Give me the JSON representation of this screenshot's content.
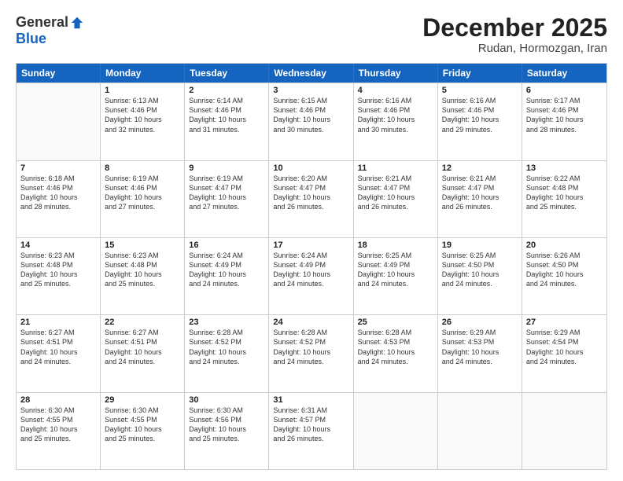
{
  "logo": {
    "general": "General",
    "blue": "Blue"
  },
  "header": {
    "month": "December 2025",
    "location": "Rudan, Hormozgan, Iran"
  },
  "days_of_week": [
    "Sunday",
    "Monday",
    "Tuesday",
    "Wednesday",
    "Thursday",
    "Friday",
    "Saturday"
  ],
  "weeks": [
    [
      {
        "day": "",
        "info": ""
      },
      {
        "day": "1",
        "info": "Sunrise: 6:13 AM\nSunset: 4:46 PM\nDaylight: 10 hours\nand 32 minutes."
      },
      {
        "day": "2",
        "info": "Sunrise: 6:14 AM\nSunset: 4:46 PM\nDaylight: 10 hours\nand 31 minutes."
      },
      {
        "day": "3",
        "info": "Sunrise: 6:15 AM\nSunset: 4:46 PM\nDaylight: 10 hours\nand 30 minutes."
      },
      {
        "day": "4",
        "info": "Sunrise: 6:16 AM\nSunset: 4:46 PM\nDaylight: 10 hours\nand 30 minutes."
      },
      {
        "day": "5",
        "info": "Sunrise: 6:16 AM\nSunset: 4:46 PM\nDaylight: 10 hours\nand 29 minutes."
      },
      {
        "day": "6",
        "info": "Sunrise: 6:17 AM\nSunset: 4:46 PM\nDaylight: 10 hours\nand 28 minutes."
      }
    ],
    [
      {
        "day": "7",
        "info": "Sunrise: 6:18 AM\nSunset: 4:46 PM\nDaylight: 10 hours\nand 28 minutes."
      },
      {
        "day": "8",
        "info": "Sunrise: 6:19 AM\nSunset: 4:46 PM\nDaylight: 10 hours\nand 27 minutes."
      },
      {
        "day": "9",
        "info": "Sunrise: 6:19 AM\nSunset: 4:47 PM\nDaylight: 10 hours\nand 27 minutes."
      },
      {
        "day": "10",
        "info": "Sunrise: 6:20 AM\nSunset: 4:47 PM\nDaylight: 10 hours\nand 26 minutes."
      },
      {
        "day": "11",
        "info": "Sunrise: 6:21 AM\nSunset: 4:47 PM\nDaylight: 10 hours\nand 26 minutes."
      },
      {
        "day": "12",
        "info": "Sunrise: 6:21 AM\nSunset: 4:47 PM\nDaylight: 10 hours\nand 26 minutes."
      },
      {
        "day": "13",
        "info": "Sunrise: 6:22 AM\nSunset: 4:48 PM\nDaylight: 10 hours\nand 25 minutes."
      }
    ],
    [
      {
        "day": "14",
        "info": "Sunrise: 6:23 AM\nSunset: 4:48 PM\nDaylight: 10 hours\nand 25 minutes."
      },
      {
        "day": "15",
        "info": "Sunrise: 6:23 AM\nSunset: 4:48 PM\nDaylight: 10 hours\nand 25 minutes."
      },
      {
        "day": "16",
        "info": "Sunrise: 6:24 AM\nSunset: 4:49 PM\nDaylight: 10 hours\nand 24 minutes."
      },
      {
        "day": "17",
        "info": "Sunrise: 6:24 AM\nSunset: 4:49 PM\nDaylight: 10 hours\nand 24 minutes."
      },
      {
        "day": "18",
        "info": "Sunrise: 6:25 AM\nSunset: 4:49 PM\nDaylight: 10 hours\nand 24 minutes."
      },
      {
        "day": "19",
        "info": "Sunrise: 6:25 AM\nSunset: 4:50 PM\nDaylight: 10 hours\nand 24 minutes."
      },
      {
        "day": "20",
        "info": "Sunrise: 6:26 AM\nSunset: 4:50 PM\nDaylight: 10 hours\nand 24 minutes."
      }
    ],
    [
      {
        "day": "21",
        "info": "Sunrise: 6:27 AM\nSunset: 4:51 PM\nDaylight: 10 hours\nand 24 minutes."
      },
      {
        "day": "22",
        "info": "Sunrise: 6:27 AM\nSunset: 4:51 PM\nDaylight: 10 hours\nand 24 minutes."
      },
      {
        "day": "23",
        "info": "Sunrise: 6:28 AM\nSunset: 4:52 PM\nDaylight: 10 hours\nand 24 minutes."
      },
      {
        "day": "24",
        "info": "Sunrise: 6:28 AM\nSunset: 4:52 PM\nDaylight: 10 hours\nand 24 minutes."
      },
      {
        "day": "25",
        "info": "Sunrise: 6:28 AM\nSunset: 4:53 PM\nDaylight: 10 hours\nand 24 minutes."
      },
      {
        "day": "26",
        "info": "Sunrise: 6:29 AM\nSunset: 4:53 PM\nDaylight: 10 hours\nand 24 minutes."
      },
      {
        "day": "27",
        "info": "Sunrise: 6:29 AM\nSunset: 4:54 PM\nDaylight: 10 hours\nand 24 minutes."
      }
    ],
    [
      {
        "day": "28",
        "info": "Sunrise: 6:30 AM\nSunset: 4:55 PM\nDaylight: 10 hours\nand 25 minutes."
      },
      {
        "day": "29",
        "info": "Sunrise: 6:30 AM\nSunset: 4:55 PM\nDaylight: 10 hours\nand 25 minutes."
      },
      {
        "day": "30",
        "info": "Sunrise: 6:30 AM\nSunset: 4:56 PM\nDaylight: 10 hours\nand 25 minutes."
      },
      {
        "day": "31",
        "info": "Sunrise: 6:31 AM\nSunset: 4:57 PM\nDaylight: 10 hours\nand 26 minutes."
      },
      {
        "day": "",
        "info": ""
      },
      {
        "day": "",
        "info": ""
      },
      {
        "day": "",
        "info": ""
      }
    ]
  ]
}
